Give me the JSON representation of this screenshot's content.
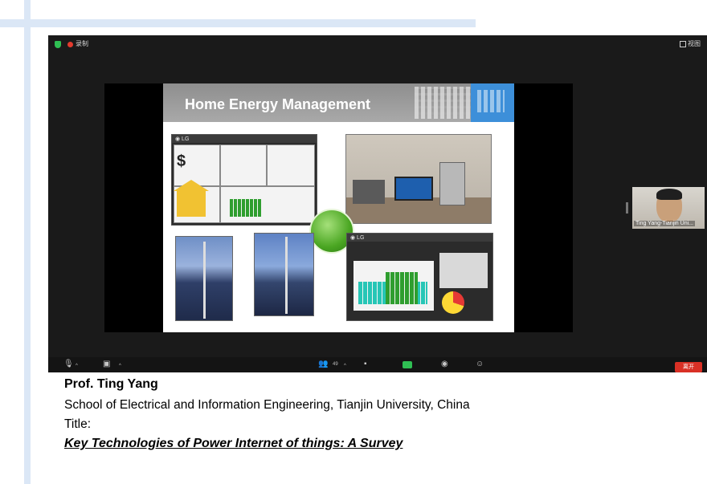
{
  "meeting": {
    "recording_label": "录制",
    "view_label": "视图",
    "participant_name": "Ting Yang-Tianjin Uni...",
    "participant_count": "49",
    "end_label": "离开"
  },
  "slide": {
    "title": "Home Energy Management"
  },
  "caption": {
    "name": "Prof. Ting Yang",
    "affiliation": "School of Electrical and Information Engineering, Tianjin University, China",
    "title_label": "Title:",
    "talk_title": "Key Technologies  of Power Internet of things:  A Survey"
  },
  "icons": [
    "shield-icon",
    "record-icon",
    "view-icon",
    "mic-muted-icon",
    "video-off-icon",
    "participants-icon",
    "chat-icon",
    "share-screen-icon",
    "record-button-icon",
    "reactions-icon"
  ],
  "colors": {
    "accent_green": "#2fbf53",
    "record_red": "#e33b2e",
    "end_red": "#d93025"
  }
}
